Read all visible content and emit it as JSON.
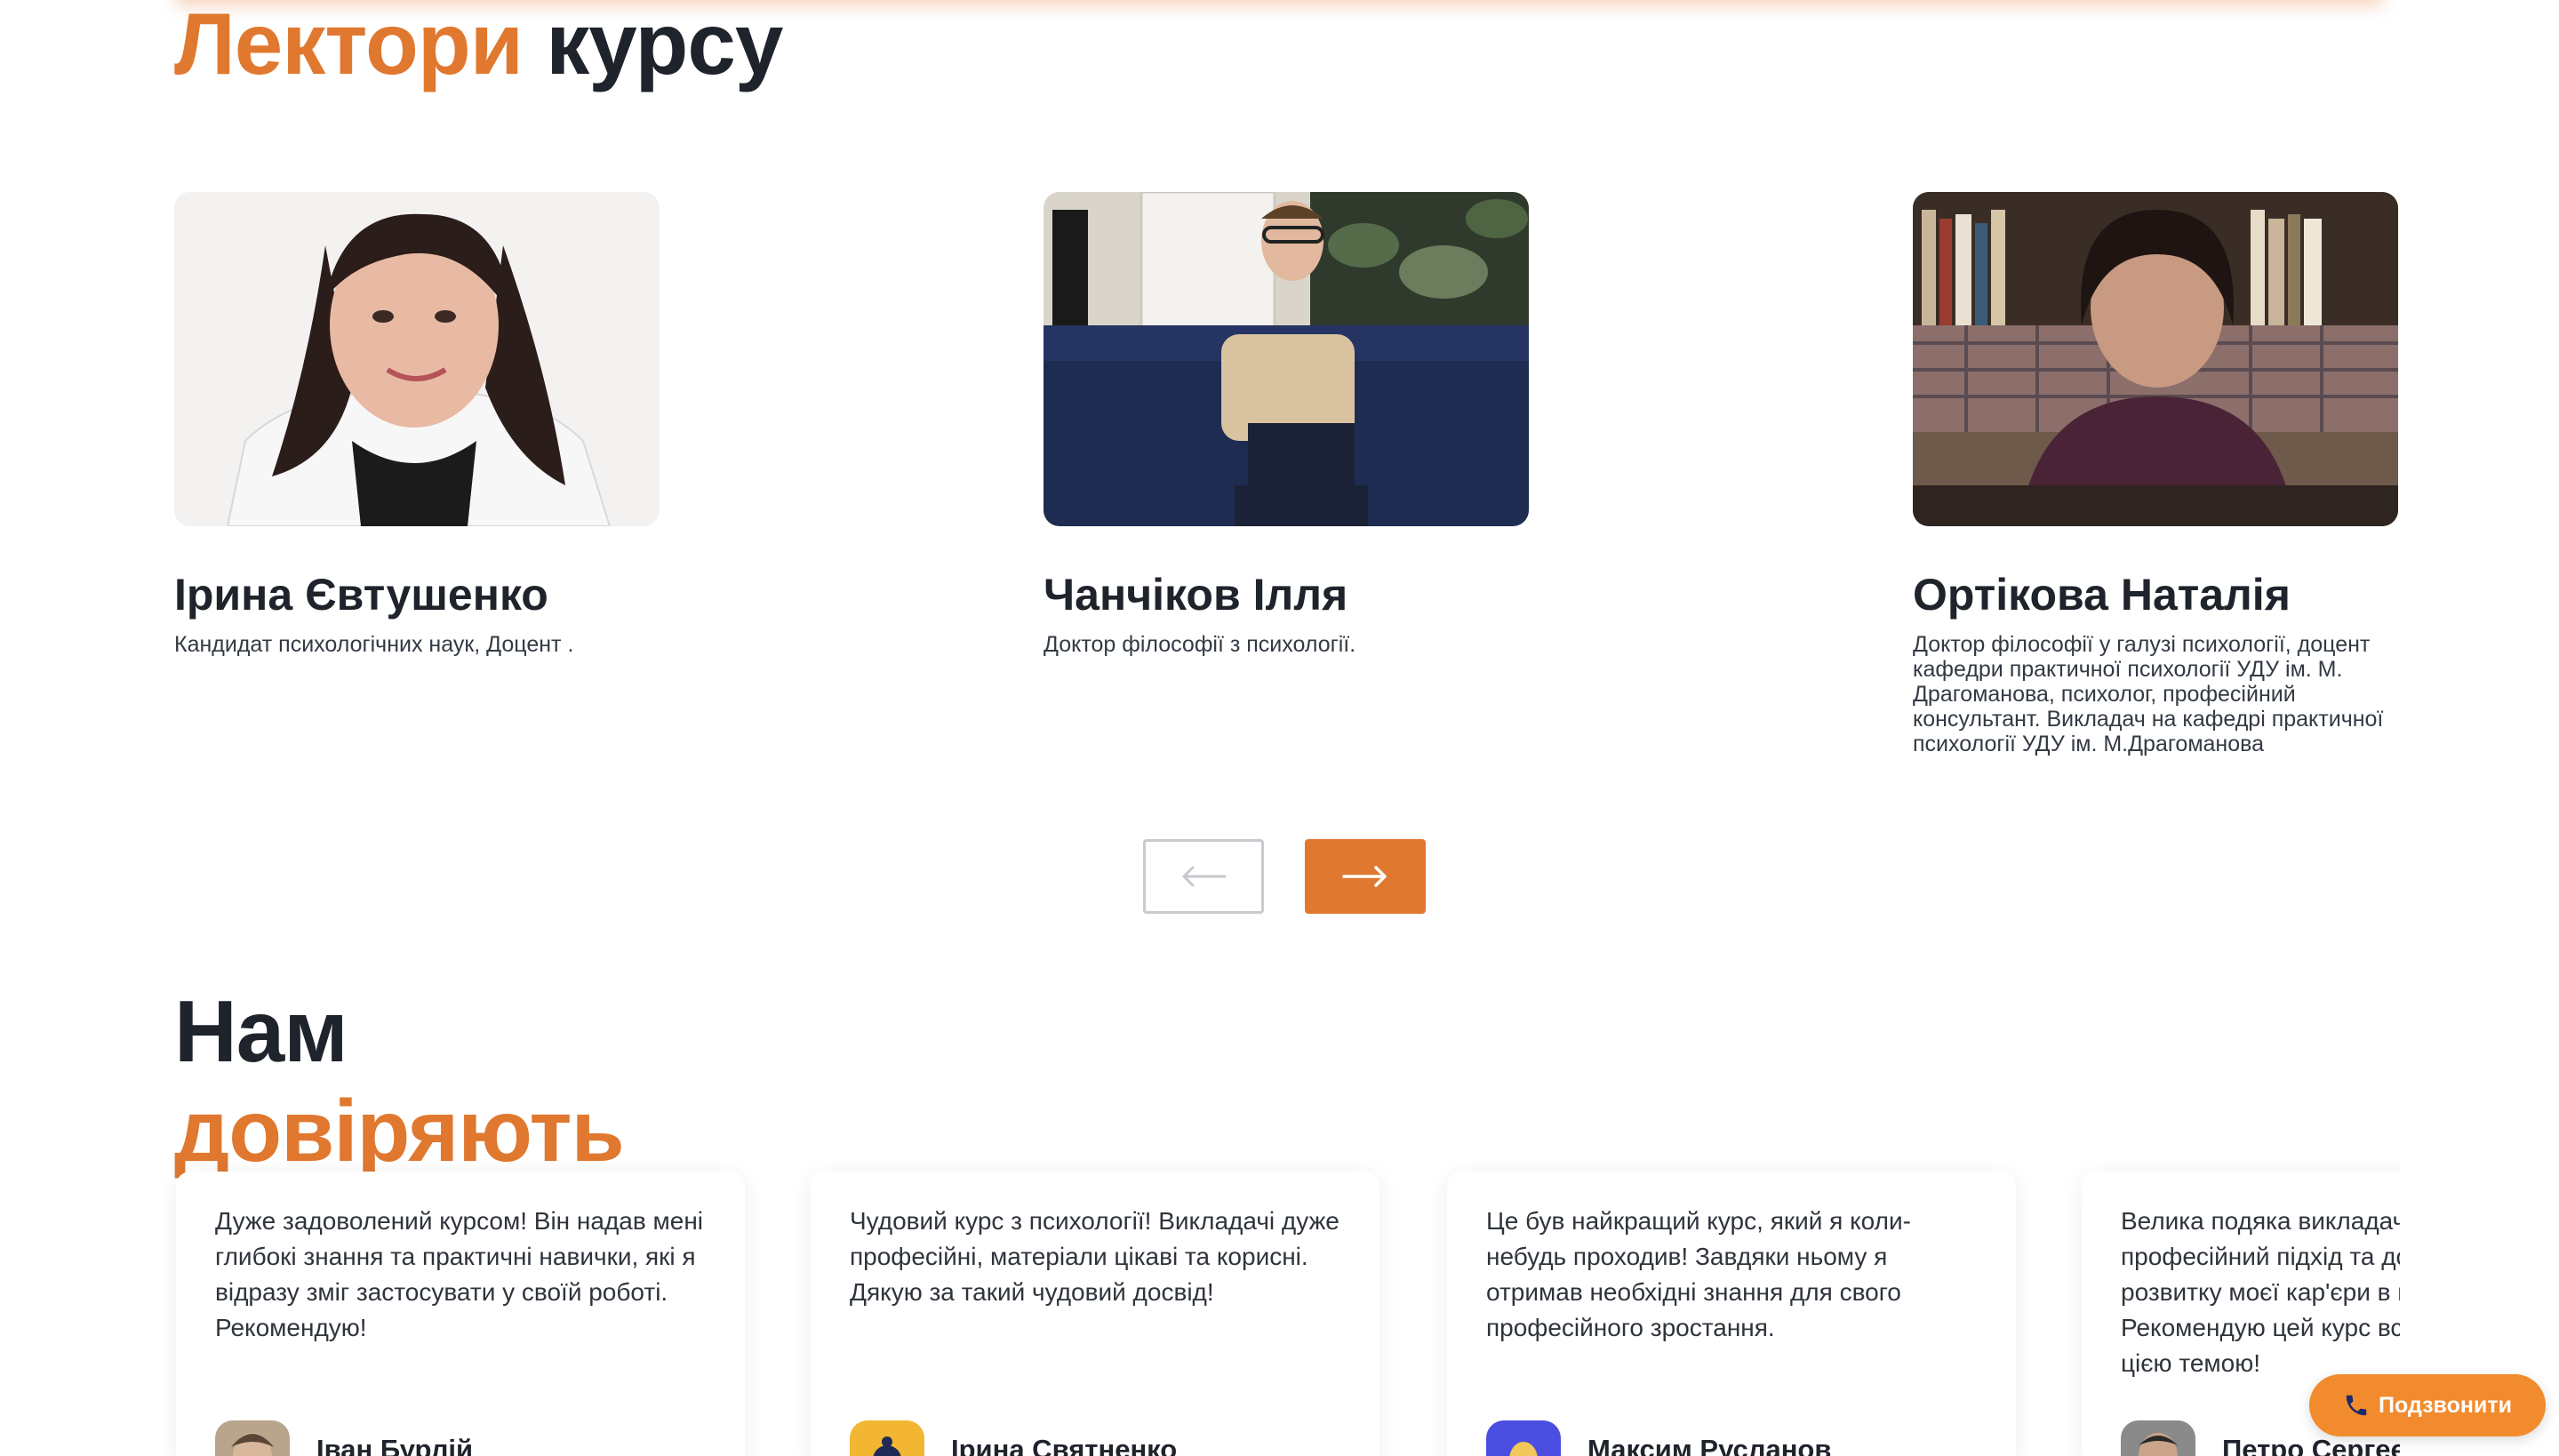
{
  "lectors_section": {
    "title_accent": "Лектори",
    "title_rest": "курсу",
    "lectors": [
      {
        "name": "Ірина Євтушенко",
        "description": "Кандидат психологічних наук, Доцент ."
      },
      {
        "name": "Чанчіков Ілля",
        "description": "Доктор філософії з психології."
      },
      {
        "name": "Ортікова Наталія",
        "description": "Доктор філософії у галузі психології, доцент кафедри практичної психології УДУ ім. М. Драгоманова, психолог, професійний консультант. Викладач на кафедрі практичної психології УДУ ім. М.Драгоманова"
      }
    ]
  },
  "trust_section": {
    "title_line1": "Нам",
    "title_line2": "довіряють",
    "reviews": [
      {
        "text": "Дуже задоволений курсом! Він надав мені глибокі знання та практичні навички, які я відразу зміг застосувати у своїй роботі. Рекомендую!",
        "author": "Іван Бурлій"
      },
      {
        "text": "Чудовий курс з психології! Викладачі дуже професійні, матеріали цікаві та корисні. Дякую за такий чудовий досвід!",
        "author": "Ірина Святненко"
      },
      {
        "text": "Це був найкращий курс, який я коли-небудь проходив! Завдяки ньому я отримав необхідні знання для свого професійного зростання.",
        "author": "Максим Русланов"
      },
      {
        "text": "Велика подяка викладачам за їх професійний підхід та допомогу в розвитку моєї кар'єри в психології. Рекомендую цей курс всім, хто цікавиться цією темою!",
        "author": "Петро Сергеєв"
      }
    ]
  },
  "call_button": {
    "label": "Подзвонити",
    "icon": "phone-icon"
  },
  "colors": {
    "accent": "#e0782f",
    "dark": "#1f232b",
    "call_button": "#f28b2e"
  }
}
